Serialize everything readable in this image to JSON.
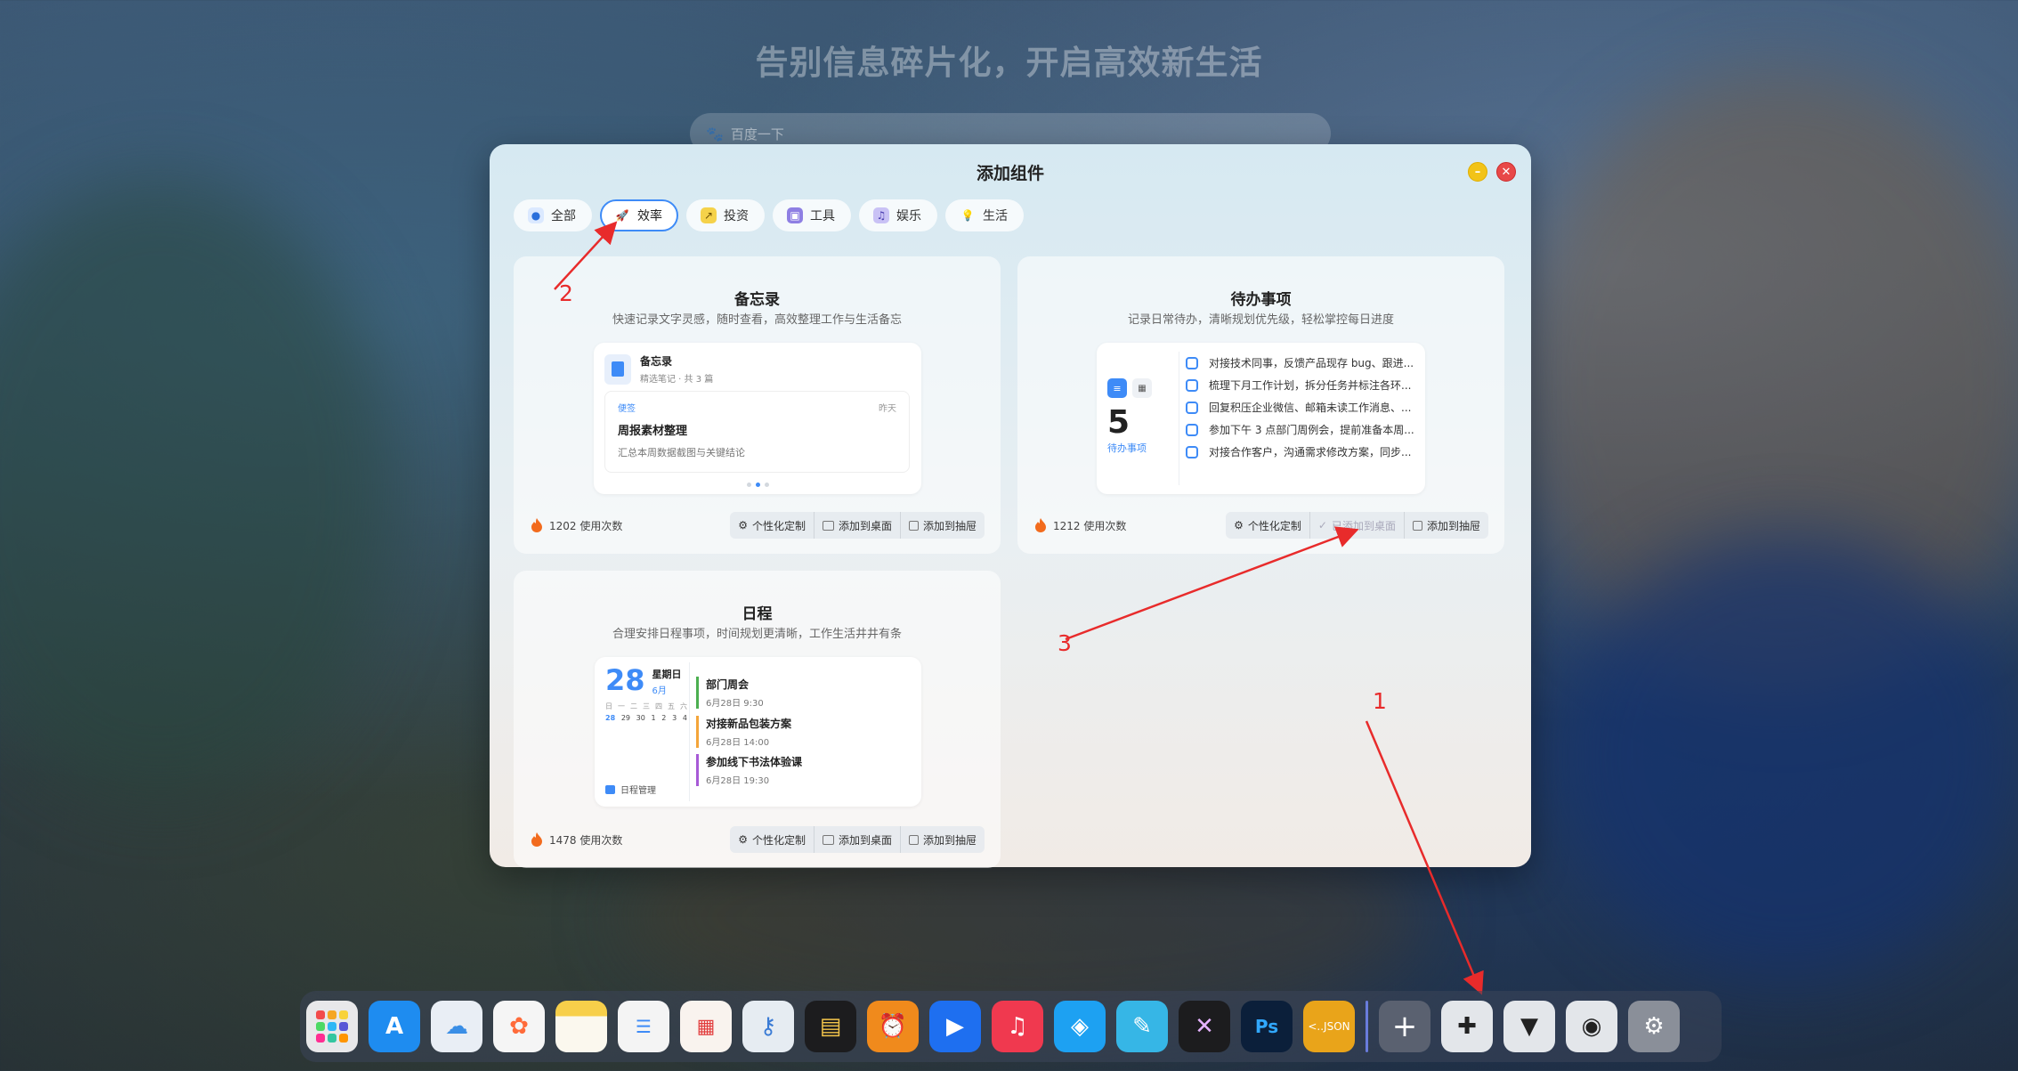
{
  "hero": {
    "title": "告别信息碎片化，开启高效新生活",
    "search_placeholder": "百度一下"
  },
  "modal": {
    "title": "添加组件",
    "tabs": [
      {
        "label": "全部",
        "icon": "globe-icon"
      },
      {
        "label": "效率",
        "icon": "rocket-icon"
      },
      {
        "label": "投资",
        "icon": "chart-icon"
      },
      {
        "label": "工具",
        "icon": "toolbox-icon"
      },
      {
        "label": "娱乐",
        "icon": "headphones-icon"
      },
      {
        "label": "生活",
        "icon": "bulb-icon"
      }
    ],
    "active_tab": "效率"
  },
  "cards": {
    "memo": {
      "title": "备忘录",
      "subtitle": "快速记录文字灵感，随时查看，高效整理工作与生活备忘",
      "preview_title": "备忘录",
      "preview_meta": "精选笔记 · 共 3 篇",
      "note_tag": "便签",
      "note_date": "昨天",
      "note_title": "周报素材整理",
      "note_desc": "汇总本周数据截图与关键结论",
      "usage": "1202 使用次数",
      "actions": [
        "个性化定制",
        "添加到桌面",
        "添加到抽屉"
      ]
    },
    "todo": {
      "title": "待办事项",
      "subtitle": "记录日常待办，清晰规划优先级，轻松掌控每日进度",
      "count": "5",
      "count_label": "待办事项",
      "items": [
        "对接技术同事，反馈产品现存 bug、跟进...",
        "梳理下月工作计划，拆分任务并标注各环...",
        "回复积压企业微信、邮箱未读工作消息、...",
        "参加下午 3 点部门周例会，提前准备本周...",
        "对接合作客户，沟通需求修改方案，同步..."
      ],
      "usage": "1212 使用次数",
      "actions": [
        "个性化定制",
        "已添加到桌面",
        "添加到抽屉"
      ]
    },
    "schedule": {
      "title": "日程",
      "subtitle": "合理安排日程事项，时间规划更清晰，工作生活井井有条",
      "day": "28",
      "weekday": "星期日",
      "month": "6月",
      "week_heads": [
        "日",
        "一",
        "二",
        "三",
        "四",
        "五",
        "六"
      ],
      "week_days": [
        "28",
        "29",
        "30",
        "1",
        "2",
        "3",
        "4"
      ],
      "footer": "日程管理",
      "events": [
        {
          "title": "部门周会",
          "time": "6月28日 9:30",
          "color": "#4caf50"
        },
        {
          "title": "对接新品包装方案",
          "time": "6月28日 14:00",
          "color": "#f4a53a"
        },
        {
          "title": "参加线下书法体验课",
          "time": "6月28日 19:30",
          "color": "#a75ad6"
        }
      ],
      "usage": "1478 使用次数",
      "actions": [
        "个性化定制",
        "添加到桌面",
        "添加到抽屉"
      ]
    }
  },
  "annotations": [
    "1",
    "2",
    "3"
  ],
  "dock": [
    {
      "name": "launchpad-icon",
      "color": "#e8e8ea"
    },
    {
      "name": "app-store-icon",
      "color": "#1e8cf0"
    },
    {
      "name": "icloud-icon",
      "color": "#e9eef5"
    },
    {
      "name": "photos-icon",
      "color": "#f5f5f5"
    },
    {
      "name": "notes-icon",
      "color": "#f7cf4a"
    },
    {
      "name": "reminders-icon",
      "color": "#f4f4f4"
    },
    {
      "name": "calendar-icon",
      "color": "#f9f3ee"
    },
    {
      "name": "keychain-icon",
      "color": "#e6ecf2"
    },
    {
      "name": "wallet-icon",
      "color": "#1c1c1e"
    },
    {
      "name": "clock-icon",
      "color": "#f08a1c"
    },
    {
      "name": "play-icon",
      "color": "#1e6ff0"
    },
    {
      "name": "music-icon",
      "color": "#f0394f"
    },
    {
      "name": "safari-icon",
      "color": "#1da1f2"
    },
    {
      "name": "pen-icon",
      "color": "#36b6e6"
    },
    {
      "name": "vscode-icon",
      "color": "#1c1c1e"
    },
    {
      "name": "photoshop-icon",
      "color": "#0b1f3a"
    },
    {
      "name": "json-icon",
      "color": "#e9a41a"
    },
    {
      "name": "add-icon",
      "color": "#5a6170"
    },
    {
      "name": "puzzle-icon",
      "color": "#e3e6ea"
    },
    {
      "name": "brush-icon",
      "color": "#e3e6ea"
    },
    {
      "name": "camera-icon",
      "color": "#e3e6ea"
    },
    {
      "name": "settings-icon",
      "color": "#8a8f99"
    }
  ],
  "dock_labels": {
    "photoshop": "Ps",
    "json": "<..JSON"
  }
}
